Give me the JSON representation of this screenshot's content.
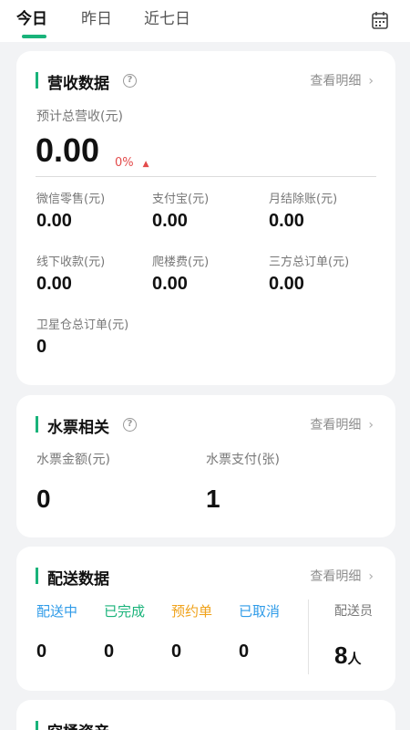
{
  "tabs": [
    {
      "label": "今日"
    },
    {
      "label": "昨日"
    },
    {
      "label": "近七日"
    }
  ],
  "revenue": {
    "title": "营收数据",
    "help": "?",
    "detail": "查看明细",
    "total_label": "预计总营收(元)",
    "total_value": "0.00",
    "change": "0%",
    "items": [
      {
        "label": "微信零售(元)",
        "value": "0.00"
      },
      {
        "label": "支付宝(元)",
        "value": "0.00"
      },
      {
        "label": "月结除账(元)",
        "value": "0.00"
      },
      {
        "label": "线下收款(元)",
        "value": "0.00"
      },
      {
        "label": "爬楼费(元)",
        "value": "0.00"
      },
      {
        "label": "三方总订单(元)",
        "value": "0.00"
      },
      {
        "label": "卫星仓总订单(元)",
        "value": "0"
      }
    ]
  },
  "water": {
    "title": "水票相关",
    "help": "?",
    "detail": "查看明细",
    "items": [
      {
        "label": "水票金额(元)",
        "value": "0"
      },
      {
        "label": "水票支付(张)",
        "value": "1"
      }
    ]
  },
  "delivery": {
    "title": "配送数据",
    "detail": "查看明细",
    "statuses": [
      {
        "label": "配送中",
        "value": "0",
        "color": "#2f9be8"
      },
      {
        "label": "已完成",
        "value": "0",
        "color": "#19b37a"
      },
      {
        "label": "预约单",
        "value": "0",
        "color": "#f0a21a"
      },
      {
        "label": "已取消",
        "value": "0",
        "color": "#2f9be8"
      }
    ],
    "staff_label": "配送员",
    "staff_value": "8",
    "staff_unit": "人"
  },
  "assets": {
    "title": "空桶资产"
  },
  "colors": {
    "accent": "#19b37a",
    "background": "#f2f3f5"
  }
}
